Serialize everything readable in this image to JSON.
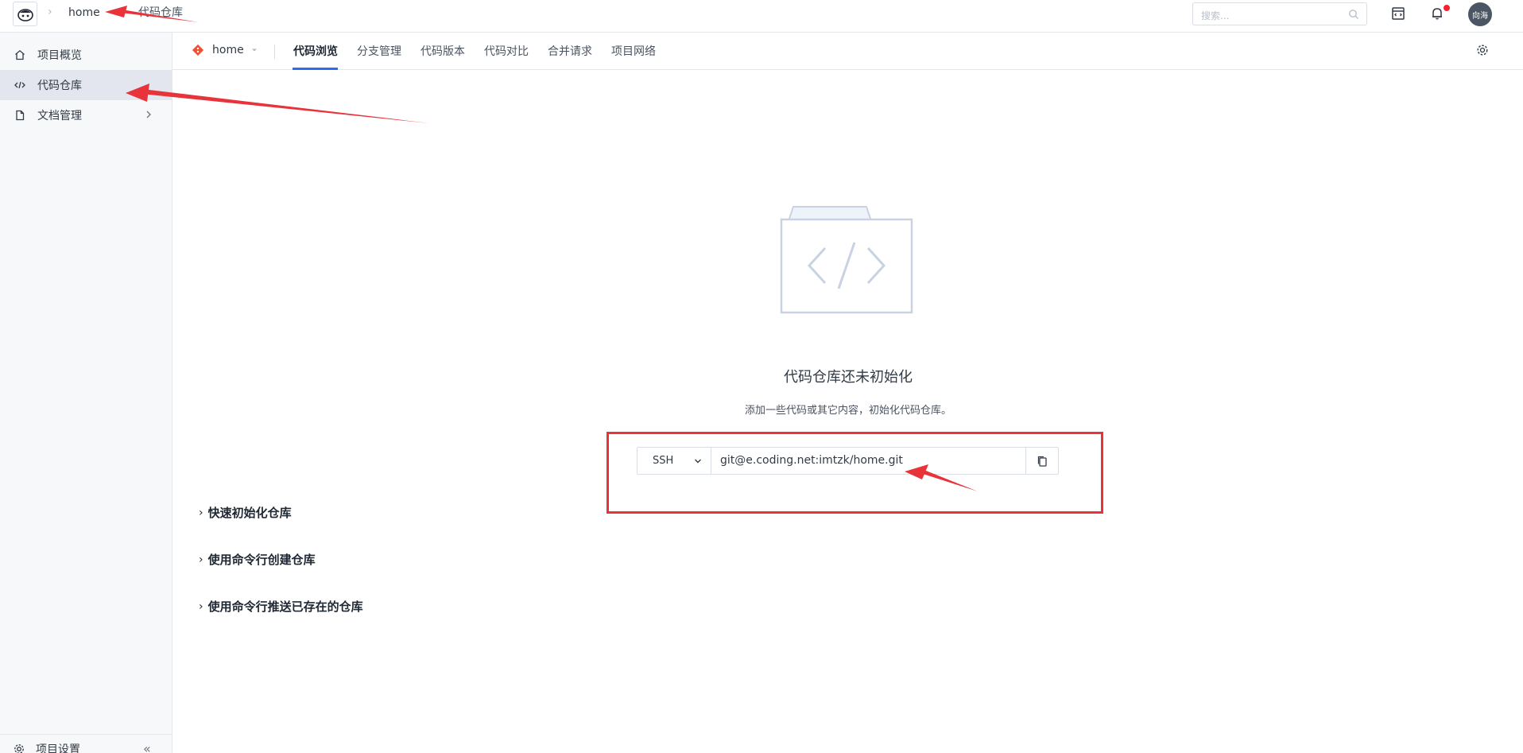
{
  "topbar": {
    "breadcrumb": [
      "home",
      "代码仓库"
    ],
    "search_placeholder": "搜索...",
    "avatar_text": "向海"
  },
  "sidebar": {
    "items": [
      {
        "label": "项目概览",
        "icon": "home-icon",
        "active": false
      },
      {
        "label": "代码仓库",
        "icon": "code-icon",
        "active": true
      },
      {
        "label": "文档管理",
        "icon": "document-icon",
        "active": false
      }
    ],
    "settings_label": "项目设置"
  },
  "subnav": {
    "repo_name": "home",
    "tabs": [
      "代码浏览",
      "分支管理",
      "代码版本",
      "代码对比",
      "合并请求",
      "项目网络"
    ],
    "active_tab": "代码浏览"
  },
  "main": {
    "empty_title": "代码仓库还未初始化",
    "empty_desc": "添加一些代码或其它内容，初始化代码仓库。",
    "protocol": "SSH",
    "clone_url": "git@e.coding.net:imtzk/home.git",
    "sections": [
      "快速初始化仓库",
      "使用命令行创建仓库",
      "使用命令行推送已存在的仓库"
    ]
  },
  "colors": {
    "accent": "#2b6cf0",
    "annotation": "#e8333b",
    "sidebar_bg": "#f7f8fa",
    "active_item_bg": "#e3e6ee"
  }
}
